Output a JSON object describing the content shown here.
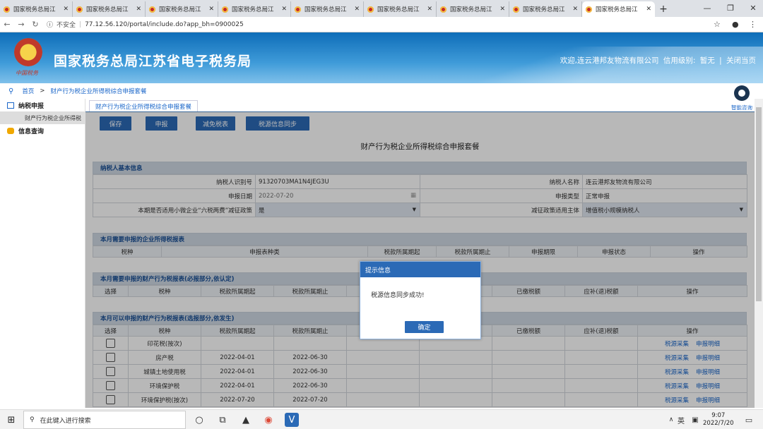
{
  "browser": {
    "tabs": [
      {
        "title": "国家税务总局江"
      },
      {
        "title": "国家税务总局江"
      },
      {
        "title": "国家税务总局江"
      },
      {
        "title": "国家税务总局江"
      },
      {
        "title": "国家税务总局江"
      },
      {
        "title": "国家税务总局江"
      },
      {
        "title": "国家税务总局江"
      },
      {
        "title": "国家税务总局江"
      },
      {
        "title": "国家税务总局江"
      }
    ],
    "security_label": "不安全",
    "url": "77.12.56.120/portal/include.do?app_bh=0900025"
  },
  "header": {
    "emblem_text": "中国税务",
    "site_title": "国家税务总局江苏省电子税务局",
    "welcome": "欢迎,连云港邦友物流有限公司",
    "credit_label": "信用级别:",
    "credit_value": "暂无",
    "sep": "|",
    "close_link": "关闭当页"
  },
  "breadcrumb": {
    "home": "首页",
    "sep": ">",
    "current": "财产行为税企业所得税综合申报套餐"
  },
  "sidebar": {
    "section1": "纳税申报",
    "sub1": "财产行为税企业所得税",
    "section2": "信息查询"
  },
  "content": {
    "tab_label": "财产行为税企业所得税综合申报套餐",
    "toolbar": {
      "save": "保存",
      "declare": "申报",
      "exempt": "减免税表",
      "sync": "税源信息同步"
    },
    "form_title": "财产行为税企业所得税综合申报套餐",
    "basic": {
      "header": "纳税人基本信息",
      "taxpayer_id_label": "纳税人识别号",
      "taxpayer_id": "91320703MA1N4JEG3U",
      "taxpayer_name_label": "纳税人名称",
      "taxpayer_name": "连云港邦友物流有限公司",
      "decl_date_label": "申报日期",
      "decl_date": "2022-07-20",
      "decl_type_label": "申报类型",
      "decl_type": "正常申报",
      "policy_label": "本期是否适用小微企业“六税两费”减征政策",
      "policy_value": "是",
      "subject_label": "减征政策适用主体",
      "subject_value": "增值税小规模纳税人"
    },
    "sec2": {
      "header": "本月需要申报的企业所得税报表",
      "cols": [
        "税种",
        "申报表种类",
        "税款所属期起",
        "税款所属期止",
        "申报期限",
        "申报状态",
        "操作"
      ]
    },
    "sec3": {
      "header": "本月需要申报的财产行为税报表(必报部分,依认定)",
      "cols": [
        "选择",
        "税种",
        "税款所属期起",
        "税款所属期止",
        "",
        "",
        "已缴税额",
        "应补(退)税额",
        "操作"
      ]
    },
    "sec4": {
      "header": "本月可以申报的财产行为税报表(选报部分,依发生)",
      "cols": [
        "选择",
        "税种",
        "税款所属期起",
        "税款所属期止",
        "",
        "",
        "已缴税额",
        "应补(退)税额",
        "操作"
      ],
      "rows": [
        {
          "tax": "印花税(按次)",
          "start": "",
          "end": ""
        },
        {
          "tax": "房产税",
          "start": "2022-04-01",
          "end": "2022-06-30"
        },
        {
          "tax": "城镇土地使用税",
          "start": "2022-04-01",
          "end": "2022-06-30"
        },
        {
          "tax": "环境保护税",
          "start": "2022-04-01",
          "end": "2022-06-30"
        },
        {
          "tax": "环境保护税(按次)",
          "start": "2022-07-20",
          "end": "2022-07-20"
        }
      ],
      "op1": "税源采集",
      "op2": "申报明细"
    }
  },
  "dialog": {
    "title": "提示信息",
    "message": "税源信息同步成功!",
    "ok": "确定"
  },
  "assistant": {
    "label": "智能咨询"
  },
  "taskbar": {
    "search_placeholder": "在此键入进行搜索",
    "ime": "英",
    "time": "9:07",
    "date": "2022/7/20"
  }
}
